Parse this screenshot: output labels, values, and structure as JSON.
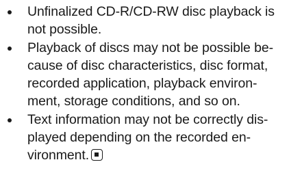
{
  "bullets": [
    {
      "lines": [
        "Unfinalized CD-R/CD-RW disc playback is",
        "not possible."
      ]
    },
    {
      "lines": [
        "Playback of discs may not be possible be-",
        "cause of disc characteristics, disc format,",
        "recorded application, playback environ-",
        "ment, storage conditions, and so on."
      ]
    },
    {
      "lines": [
        "Text information may not be correctly dis-",
        "played depending on the recorded en-",
        "vironment."
      ]
    }
  ],
  "end_mark_icon": "end-of-section-icon"
}
